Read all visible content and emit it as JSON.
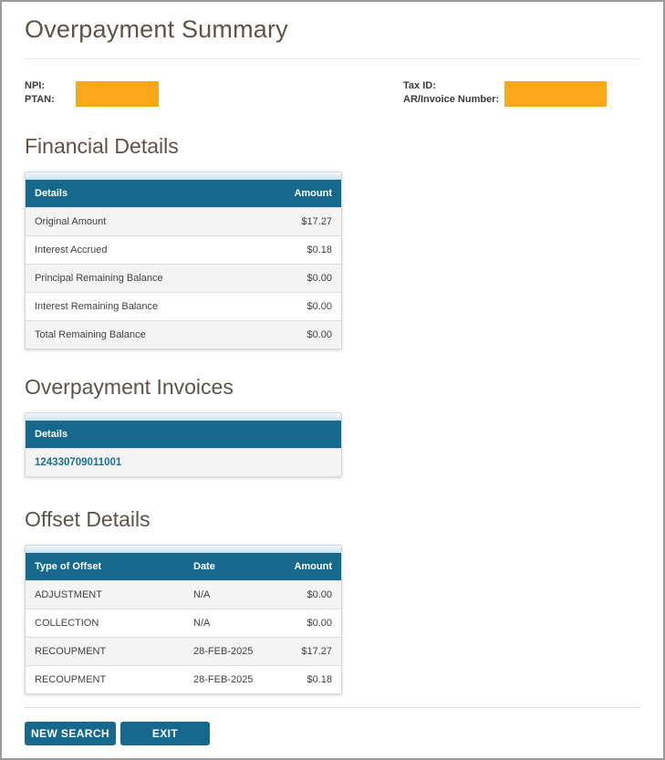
{
  "page": {
    "title": "Overpayment Summary"
  },
  "info": {
    "npi_label": "NPI:",
    "ptan_label": "PTAN:",
    "taxid_label": "Tax ID:",
    "ar_invoice_label": "AR/Invoice Number:",
    "redacted_value_note": "value hidden by orange redaction box"
  },
  "financial": {
    "heading": "Financial Details",
    "columns": [
      "Details",
      "Amount"
    ],
    "rows": [
      {
        "label": "Original Amount",
        "amount": "$17.27"
      },
      {
        "label": "Interest Accrued",
        "amount": "$0.18"
      },
      {
        "label": "Principal Remaining Balance",
        "amount": "$0.00"
      },
      {
        "label": "Interest Remaining Balance",
        "amount": "$0.00"
      },
      {
        "label": "Total Remaining Balance",
        "amount": "$0.00"
      }
    ]
  },
  "invoices": {
    "heading": "Overpayment Invoices",
    "columns": [
      "Details"
    ],
    "rows": [
      {
        "link": "124330709011001"
      }
    ]
  },
  "offsets": {
    "heading": "Offset Details",
    "columns": [
      "Type of Offset",
      "Date",
      "Amount"
    ],
    "rows": [
      {
        "type": "ADJUSTMENT",
        "date": "N/A",
        "amount": "$0.00"
      },
      {
        "type": "COLLECTION",
        "date": "N/A",
        "amount": "$0.00"
      },
      {
        "type": "RECOUPMENT",
        "date": "28-FEB-2025",
        "amount": "$17.27"
      },
      {
        "type": "RECOUPMENT",
        "date": "28-FEB-2025",
        "amount": "$0.18"
      }
    ]
  },
  "actions": {
    "new_search": "NEW SEARCH",
    "exit": "EXIT"
  },
  "colors": {
    "table_header_teal": "#16698c",
    "button_teal": "#16698c",
    "redaction_orange": "#f9a81b",
    "heading_text": "#5d5349",
    "link_teal": "#17708f",
    "row_alt_bg": "#f4f4f4",
    "page_border": "#9b9b9b"
  }
}
